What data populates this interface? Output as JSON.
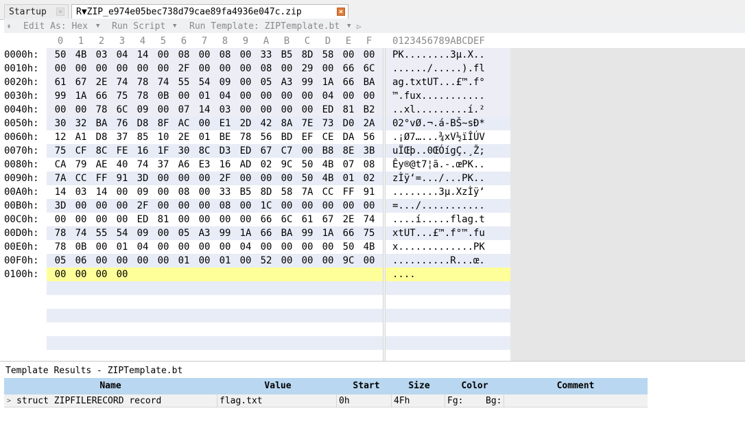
{
  "tabs": [
    {
      "label": "Startup"
    },
    {
      "label": "R▼ZIP_e974e05bec738d79cae89fa4936e047c.zip"
    }
  ],
  "toolbar": {
    "edit_as": "Edit As: Hex",
    "run_script": "Run Script",
    "run_template": "Run Template: ZIPTemplate.bt"
  },
  "hex": {
    "columns": [
      "0",
      "1",
      "2",
      "3",
      "4",
      "5",
      "6",
      "7",
      "8",
      "9",
      "A",
      "B",
      "C",
      "D",
      "E",
      "F"
    ],
    "ascii_header": "0123456789ABCDEF",
    "rows": [
      {
        "addr": "0000h:",
        "bytes": [
          "50",
          "4B",
          "03",
          "04",
          "14",
          "00",
          "08",
          "00",
          "08",
          "00",
          "33",
          "B5",
          "8D",
          "58",
          "00",
          "00"
        ],
        "ascii": "PK........3µ.X.."
      },
      {
        "addr": "0010h:",
        "bytes": [
          "00",
          "00",
          "00",
          "00",
          "00",
          "00",
          "2F",
          "00",
          "00",
          "00",
          "08",
          "00",
          "29",
          "00",
          "66",
          "6C"
        ],
        "ascii": "....../.....).fl"
      },
      {
        "addr": "0020h:",
        "bytes": [
          "61",
          "67",
          "2E",
          "74",
          "78",
          "74",
          "55",
          "54",
          "09",
          "00",
          "05",
          "A3",
          "99",
          "1A",
          "66",
          "BA"
        ],
        "ascii": "ag.txtUT...£™.f°"
      },
      {
        "addr": "0030h:",
        "bytes": [
          "99",
          "1A",
          "66",
          "75",
          "78",
          "0B",
          "00",
          "01",
          "04",
          "00",
          "00",
          "00",
          "00",
          "04",
          "00",
          "00"
        ],
        "ascii": "™.fux..........."
      },
      {
        "addr": "0040h:",
        "bytes": [
          "00",
          "00",
          "78",
          "6C",
          "09",
          "00",
          "07",
          "14",
          "03",
          "00",
          "00",
          "00",
          "00",
          "ED",
          "81",
          "B2"
        ],
        "ascii": "..xl.........í.²"
      },
      {
        "addr": "0050h:",
        "bytes": [
          "30",
          "32",
          "BA",
          "76",
          "D8",
          "8F",
          "AC",
          "00",
          "E1",
          "2D",
          "42",
          "8A",
          "7E",
          "73",
          "D0",
          "2A"
        ],
        "ascii": "02°vØ.¬.á-BŠ~sÐ*"
      },
      {
        "addr": "0060h:",
        "bytes": [
          "12",
          "A1",
          "D8",
          "37",
          "85",
          "10",
          "2E",
          "01",
          "BE",
          "78",
          "56",
          "BD",
          "EF",
          "CE",
          "DA",
          "56"
        ],
        "ascii": ".¡Ø7…...¾xV½ïÎÚV"
      },
      {
        "addr": "0070h:",
        "bytes": [
          "75",
          "CF",
          "8C",
          "FE",
          "16",
          "1F",
          "30",
          "8C",
          "D3",
          "ED",
          "67",
          "C7",
          "00",
          "B8",
          "8E",
          "3B"
        ],
        "ascii": "uÏŒþ..0ŒÓígÇ.¸Ž;"
      },
      {
        "addr": "0080h:",
        "bytes": [
          "CA",
          "79",
          "AE",
          "40",
          "74",
          "37",
          "A6",
          "E3",
          "16",
          "AD",
          "02",
          "9C",
          "50",
          "4B",
          "07",
          "08"
        ],
        "ascii": "Êy®@t7¦ã.-.œPK.."
      },
      {
        "addr": "0090h:",
        "bytes": [
          "7A",
          "CC",
          "FF",
          "91",
          "3D",
          "00",
          "00",
          "00",
          "2F",
          "00",
          "00",
          "00",
          "50",
          "4B",
          "01",
          "02"
        ],
        "ascii": "zÌÿ‘=.../...PK.."
      },
      {
        "addr": "00A0h:",
        "bytes": [
          "14",
          "03",
          "14",
          "00",
          "09",
          "00",
          "08",
          "00",
          "33",
          "B5",
          "8D",
          "58",
          "7A",
          "CC",
          "FF",
          "91"
        ],
        "ascii": "........3µ.XzÌÿ‘"
      },
      {
        "addr": "00B0h:",
        "bytes": [
          "3D",
          "00",
          "00",
          "00",
          "2F",
          "00",
          "00",
          "00",
          "08",
          "00",
          "1C",
          "00",
          "00",
          "00",
          "00",
          "00"
        ],
        "ascii": "=.../..........."
      },
      {
        "addr": "00C0h:",
        "bytes": [
          "00",
          "00",
          "00",
          "00",
          "ED",
          "81",
          "00",
          "00",
          "00",
          "00",
          "66",
          "6C",
          "61",
          "67",
          "2E",
          "74"
        ],
        "ascii": "....í.....flag.t"
      },
      {
        "addr": "00D0h:",
        "bytes": [
          "78",
          "74",
          "55",
          "54",
          "09",
          "00",
          "05",
          "A3",
          "99",
          "1A",
          "66",
          "BA",
          "99",
          "1A",
          "66",
          "75"
        ],
        "ascii": "xtUT...£™.f°™.fu"
      },
      {
        "addr": "00E0h:",
        "bytes": [
          "78",
          "0B",
          "00",
          "01",
          "04",
          "00",
          "00",
          "00",
          "00",
          "04",
          "00",
          "00",
          "00",
          "00",
          "50",
          "4B"
        ],
        "ascii": "x.............PK"
      },
      {
        "addr": "00F0h:",
        "bytes": [
          "05",
          "06",
          "00",
          "00",
          "00",
          "00",
          "01",
          "00",
          "01",
          "00",
          "52",
          "00",
          "00",
          "00",
          "9C",
          "00"
        ],
        "ascii": "..........R...œ."
      },
      {
        "addr": "0100h:",
        "bytes": [
          "00",
          "00",
          "00",
          "00"
        ],
        "ascii": "...."
      }
    ]
  },
  "results": {
    "title": "Template Results - ZIPTemplate.bt",
    "headers": {
      "name": "Name",
      "value": "Value",
      "start": "Start",
      "size": "Size",
      "color": "Color",
      "comment": "Comment"
    },
    "row": {
      "name": "struct ZIPFILERECORD record",
      "value": "flag.txt",
      "start": "0h",
      "size": "4Fh",
      "fg": "Fg:",
      "bg": "Bg:"
    }
  },
  "colors": {
    "highlight": "#ededf5",
    "alt_band": "#e8ecf6",
    "selection": "#ffff99",
    "header_blue": "#b9d7f0"
  }
}
